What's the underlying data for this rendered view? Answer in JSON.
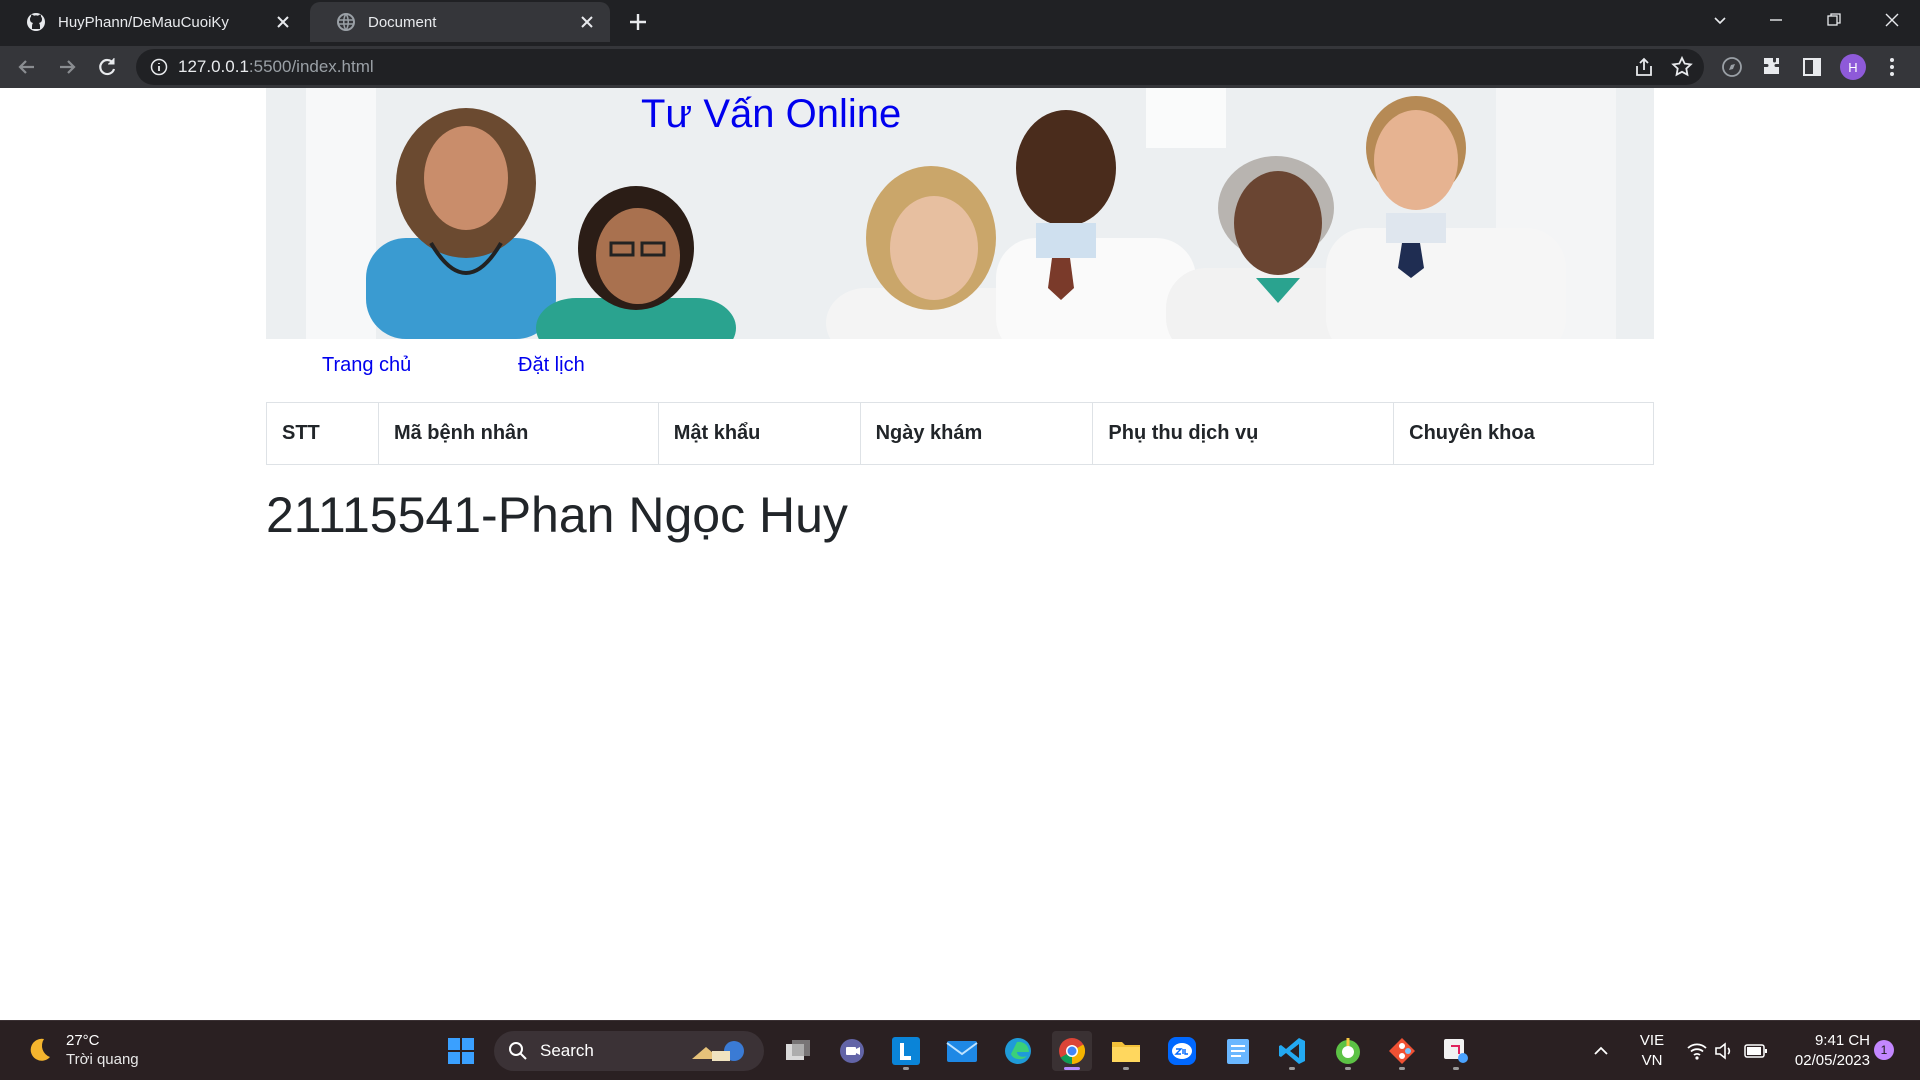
{
  "browser": {
    "tabs": [
      {
        "label": "HuyPhann/DeMauCuoiKy",
        "active": false,
        "icon": "github-icon"
      },
      {
        "label": "Document",
        "active": true,
        "icon": "globe-icon"
      }
    ],
    "url_host": "127.0.0.1",
    "url_path": ":5500/index.html",
    "profile_initial": "H"
  },
  "page": {
    "banner_title": "Tư Vấn Online",
    "nav": [
      "Trang chủ",
      "Đặt lịch"
    ],
    "table_headers": [
      "STT",
      "Mã bệnh nhân",
      "Mật khẩu",
      "Ngày khám",
      "Phụ thu dịch vụ",
      "Chuyên khoa"
    ],
    "student": "21115541-Phan Ngọc Huy"
  },
  "taskbar": {
    "weather_temp": "27°C",
    "weather_desc": "Trời quang",
    "search_label": "Search",
    "lang_top": "VIE",
    "lang_bottom": "VN",
    "time": "9:41 CH",
    "date": "02/05/2023",
    "notifications": "1"
  },
  "colors": {
    "link": "#0000ee",
    "taskbar_bg": "#2a2022",
    "chrome_bg": "#202124"
  }
}
